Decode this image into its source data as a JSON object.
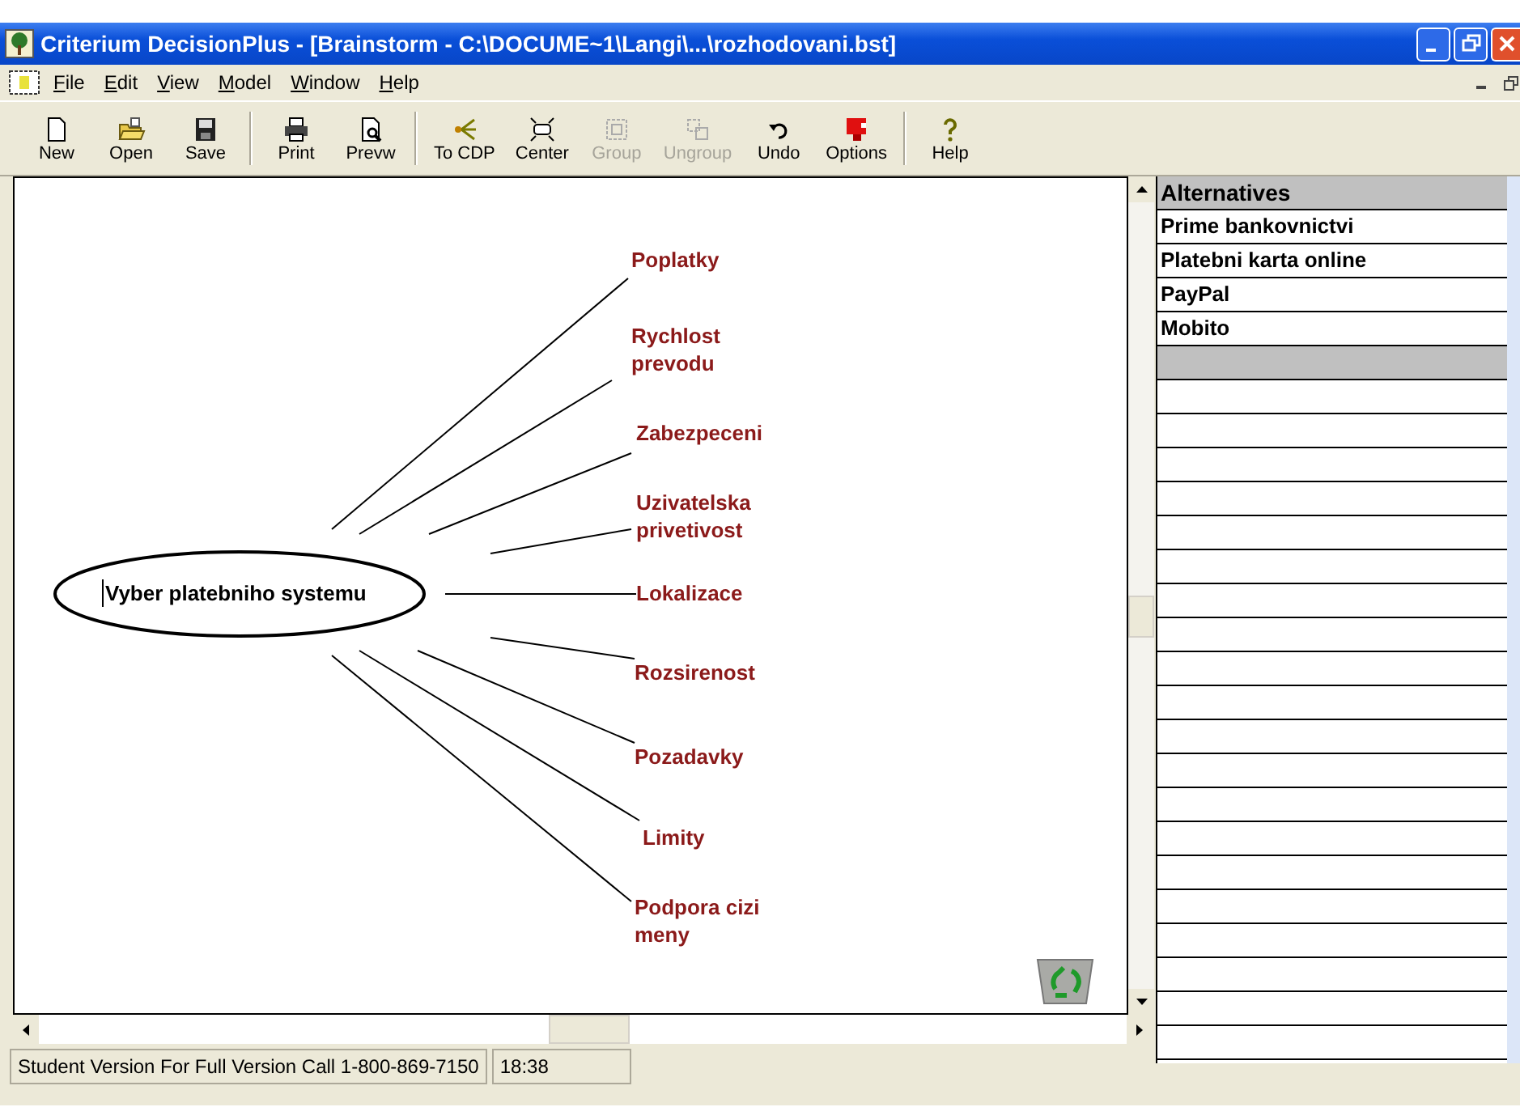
{
  "window": {
    "title": "Criterium DecisionPlus - [Brainstorm - C:\\DOCUME~1\\Langi\\...\\rozhodovani.bst]"
  },
  "menu": [
    {
      "label": "File"
    },
    {
      "label": "Edit"
    },
    {
      "label": "View"
    },
    {
      "label": "Model"
    },
    {
      "label": "Window"
    },
    {
      "label": "Help"
    }
  ],
  "toolbar": [
    {
      "label": "New",
      "kind": "new",
      "disabled": false
    },
    {
      "label": "Open",
      "kind": "open",
      "disabled": false
    },
    {
      "label": "Save",
      "kind": "save",
      "disabled": false,
      "separator_after": true
    },
    {
      "label": "Print",
      "kind": "print",
      "disabled": false
    },
    {
      "label": "Prevw",
      "kind": "preview",
      "disabled": false,
      "separator_after": true
    },
    {
      "label": "To CDP",
      "kind": "tocdp",
      "disabled": false
    },
    {
      "label": "Center",
      "kind": "center",
      "disabled": false
    },
    {
      "label": "Group",
      "kind": "group",
      "disabled": true
    },
    {
      "label": "Ungroup",
      "kind": "ungroup",
      "disabled": true
    },
    {
      "label": "Undo",
      "kind": "undo",
      "disabled": false
    },
    {
      "label": "Options",
      "kind": "options",
      "disabled": false,
      "separator_after": true
    },
    {
      "label": "Help",
      "kind": "help",
      "disabled": false
    }
  ],
  "brainstorm": {
    "goal": "Vyber platebniho systemu",
    "criteria": [
      "Poplatky",
      "Rychlost\nprevodu",
      "Zabezpeceni",
      "Uzivatelska\nprivetivost",
      "Lokalizace",
      "Rozsirenost",
      "Pozadavky",
      "Limity",
      "Podpora cizi\nmeny"
    ]
  },
  "alternatives": {
    "title": "Alternatives",
    "rows": [
      "Prime bankovnictvi",
      "Platebni karta online",
      "PayPal",
      "Mobito"
    ]
  },
  "status_bar": [
    "Student Version For Full Version Call 1-800-869-7150",
    "18:38"
  ]
}
